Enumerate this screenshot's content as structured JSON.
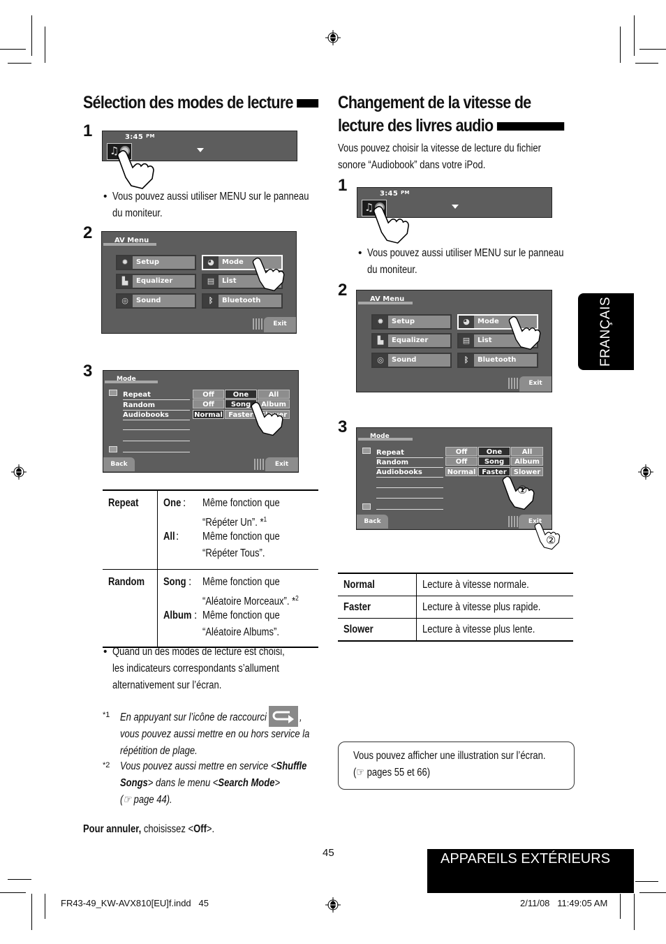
{
  "left": {
    "title": "Sélection des modes de lecture",
    "step1": {
      "num": "1",
      "time": "3:45",
      "ampm": "PM",
      "bullet": "Vous pouvez aussi utiliser MENU sur le panneau",
      "bullet2": "du moniteur."
    },
    "step2": {
      "num": "2",
      "menu_title": "AV Menu",
      "items": [
        "Setup",
        "Equalizer",
        "Sound",
        "Mode",
        "List",
        "Bluetooth"
      ],
      "exit": "Exit"
    },
    "step3": {
      "num": "3",
      "menu_title": "Mode",
      "rows": [
        "Repeat",
        "Random",
        "Audiobooks"
      ],
      "repeat_opts": [
        "Off",
        "One",
        "All"
      ],
      "random_opts": [
        "Off",
        "Song",
        "Album"
      ],
      "audio_opts": [
        "Normal",
        "Faster",
        "Slower"
      ],
      "back": "Back",
      "exit": "Exit"
    },
    "table": {
      "repeat": {
        "label": "Repeat",
        "one_key": "One",
        "one_l1": "Même fonction que",
        "one_l2": "“Répéter Un”. *",
        "one_sup": "1",
        "all_key": "All",
        "all_l1": "Même fonction que",
        "all_l2": "“Répéter Tous”."
      },
      "random": {
        "label": "Random",
        "song_key": "Song",
        "song_l1": "Même fonction que",
        "song_l2": "“Aléatoire Morceaux”. *",
        "song_sup": "2",
        "album_key": "Album",
        "album_l1": "Même fonction que",
        "album_l2": "“Aléatoire Albums”."
      }
    },
    "bullet2": [
      "Quand un des modes de lecture est choisi,",
      "les indicateurs correspondants s’allument",
      "alternativement sur l’écran."
    ],
    "fn1": {
      "mark": "*1",
      "l1": "En appuyant sur l’icône de raccourci",
      "l1_end": ",",
      "l2": "vous pouvez aussi mettre en ou hors service la",
      "l3": "répétition de plage."
    },
    "fn2": {
      "mark": "*2",
      "l1a": "Vous pouvez aussi mettre en service <",
      "l1b": "Shuffle",
      "l2a": "Songs",
      "l2b": "> dans le menu <",
      "l2c": "Search Mode",
      "l2d": ">",
      "l3": "(☞ page 44)."
    },
    "cancel": {
      "bold": "Pour annuler,",
      "text": " choisissez <",
      "off": "Off",
      "end": ">."
    }
  },
  "right": {
    "title_l1": "Changement de la vitesse de",
    "title_l2": "lecture des livres audio",
    "intro": [
      "Vous pouvez choisir la vitesse de lecture du fichier",
      "sonore “Audiobook” dans votre iPod."
    ],
    "step1": {
      "num": "1",
      "time": "3:45",
      "ampm": "PM",
      "bullet": "Vous pouvez aussi utiliser MENU sur le panneau",
      "bullet2": "du moniteur."
    },
    "step2": {
      "num": "2",
      "menu_title": "AV Menu",
      "items": [
        "Setup",
        "Equalizer",
        "Sound",
        "Mode",
        "List",
        "Bluetooth"
      ],
      "exit": "Exit"
    },
    "step3": {
      "num": "3",
      "menu_title": "Mode",
      "rows": [
        "Repeat",
        "Random",
        "Audiobooks"
      ],
      "repeat_opts": [
        "Off",
        "One",
        "All"
      ],
      "random_opts": [
        "Off",
        "Song",
        "Album"
      ],
      "audio_opts": [
        "Normal",
        "Faster",
        "Slower"
      ],
      "back": "Back",
      "exit": "Exit",
      "callout1": "①",
      "callout2": "②"
    },
    "table": [
      {
        "key": "Normal",
        "desc": "Lecture à vitesse normale."
      },
      {
        "key": "Faster",
        "desc": "Lecture à vitesse plus rapide."
      },
      {
        "key": "Slower",
        "desc": "Lecture à vitesse plus lente."
      }
    ],
    "note": [
      "Vous pouvez afficher une illustration sur l’écran.",
      "(☞ pages 55 et 66)"
    ]
  },
  "sidetab": "FRANÇAIS",
  "page_number": "45",
  "chapter": "APPAREILS EXTÉRIEURS",
  "slug": {
    "file": "FR43-49_KW-AVX810[EU]f.indd   45",
    "date": "2/11/08   11:49:05 AM"
  }
}
